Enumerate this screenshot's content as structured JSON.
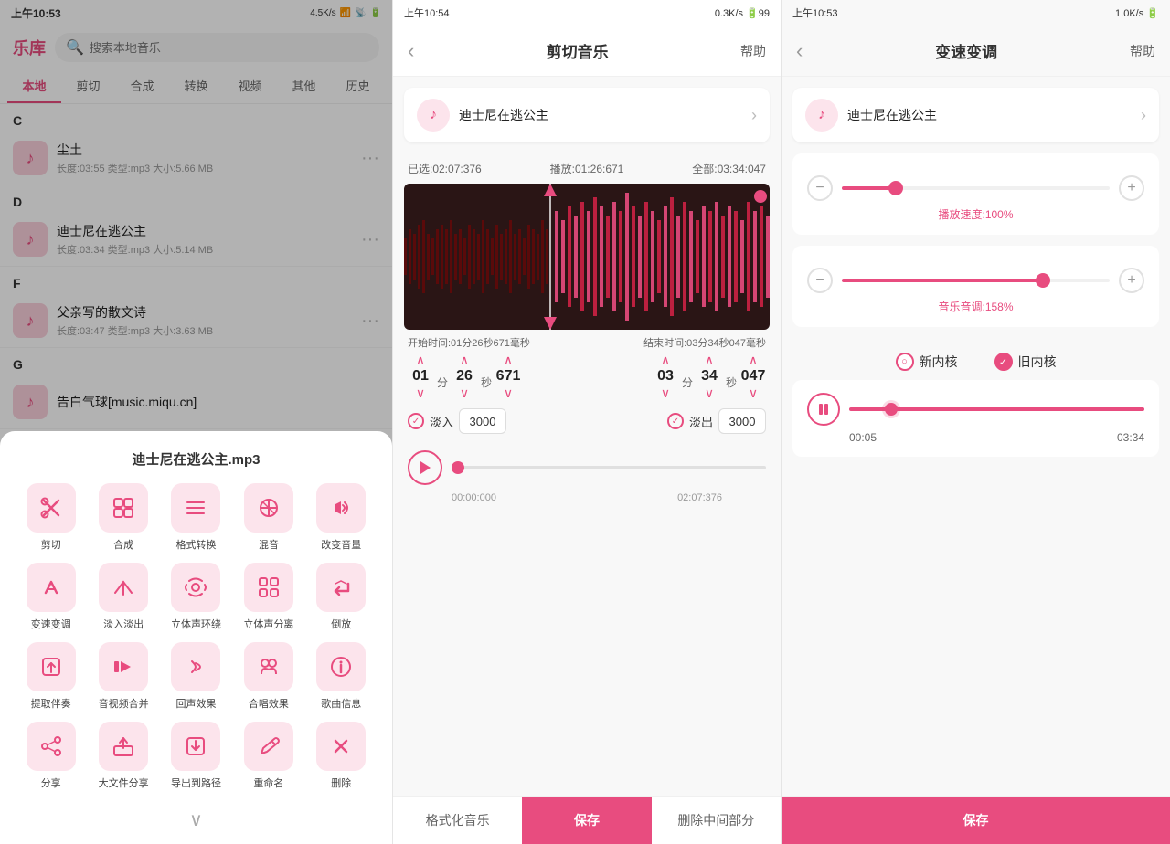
{
  "panel1": {
    "status": {
      "time": "上午10:53",
      "speed": "4.5K/s",
      "battery": "40"
    },
    "title": "乐库",
    "search_placeholder": "搜索本地音乐",
    "tabs": [
      "本地",
      "剪切",
      "合成",
      "转换",
      "视频",
      "其他",
      "历史"
    ],
    "active_tab": "本地",
    "sections": [
      {
        "label": "C",
        "songs": [
          {
            "title": "尘土",
            "meta": "长度:03:55  类型:mp3  大小:5.66 MB"
          }
        ]
      },
      {
        "label": "D",
        "songs": [
          {
            "title": "迪士尼在逃公主",
            "meta": "长度:03:34  类型:mp3  大小:5.14 MB"
          }
        ]
      },
      {
        "label": "F",
        "songs": [
          {
            "title": "父亲写的散文诗",
            "meta": "长度:03:47  类型:mp3  大小:3.63 MB"
          }
        ]
      },
      {
        "label": "G",
        "songs": [
          {
            "title": "告白气球[music.miqu.cn]",
            "meta": ""
          }
        ]
      }
    ],
    "modal": {
      "title": "迪士尼在逃公主.mp3",
      "items": [
        {
          "icon": "✂",
          "label": "剪切"
        },
        {
          "icon": "⊞",
          "label": "合成"
        },
        {
          "icon": "≡",
          "label": "格式转换"
        },
        {
          "icon": "⊕",
          "label": "混音"
        },
        {
          "icon": "♪",
          "label": "改变音量"
        },
        {
          "icon": "↗",
          "label": "变速变调"
        },
        {
          "icon": "◁",
          "label": "淡入淡出"
        },
        {
          "icon": "◎",
          "label": "立体声环绕"
        },
        {
          "icon": "⋮⋮",
          "label": "立体声分离"
        },
        {
          "icon": "↩",
          "label": "倒放"
        },
        {
          "icon": "↑",
          "label": "提取伴奏"
        },
        {
          "icon": "▶",
          "label": "音视频合并"
        },
        {
          "icon": ")",
          "label": "回声效果"
        },
        {
          "icon": "♫",
          "label": "合唱效果"
        },
        {
          "icon": "ℹ",
          "label": "歌曲信息"
        },
        {
          "icon": "↗",
          "label": "分享"
        },
        {
          "icon": "📤",
          "label": "大文件分享"
        },
        {
          "icon": "⤴",
          "label": "导出到路径"
        },
        {
          "icon": "✏",
          "label": "重命名"
        },
        {
          "icon": "✕",
          "label": "删除"
        }
      ]
    }
  },
  "panel2": {
    "status": {
      "time": "上午10:54",
      "speed": "0.3K/s"
    },
    "title": "剪切音乐",
    "help": "帮助",
    "track_name": "迪士尼在逃公主",
    "selected": "已选:02:07:376",
    "playback": "播放:01:26:671",
    "total": "全部:03:34:047",
    "start_label": "开始时间:01分26秒671毫秒",
    "end_label": "结束时间:03分34秒047毫秒",
    "start_h": "01",
    "start_m": "分",
    "start_s": "26",
    "start_ms": "671",
    "end_h": "03",
    "end_m": "分",
    "end_s": "34",
    "end_ms": "047",
    "start_min_val": "01",
    "start_sec_val": "26",
    "start_ms_val": "671",
    "end_min_val": "03",
    "end_sec_val": "34",
    "end_ms_val": "047",
    "fade_in_label": "淡入",
    "fade_in_val": "3000",
    "fade_out_label": "淡出",
    "fade_out_val": "3000",
    "progress_current": "00:00:000",
    "progress_end": "02:07:376",
    "progress_pct": 0,
    "btn_format": "格式化音乐",
    "btn_save": "保存",
    "btn_delete_mid": "删除中间部分"
  },
  "panel3": {
    "status": {
      "time": "上午10:53",
      "speed": "1.0K/s"
    },
    "title": "变速变调",
    "help": "帮助",
    "track_name": "迪士尼在逃公主",
    "speed_label": "播放速度:100%",
    "speed_pct": 20,
    "pitch_label": "音乐音调:158%",
    "pitch_pct": 75,
    "kernel_new": "新内核",
    "kernel_old": "旧内核",
    "playback_current": "00:05",
    "playback_total": "03:34",
    "playback_pct": 12,
    "btn_save": "保存"
  }
}
